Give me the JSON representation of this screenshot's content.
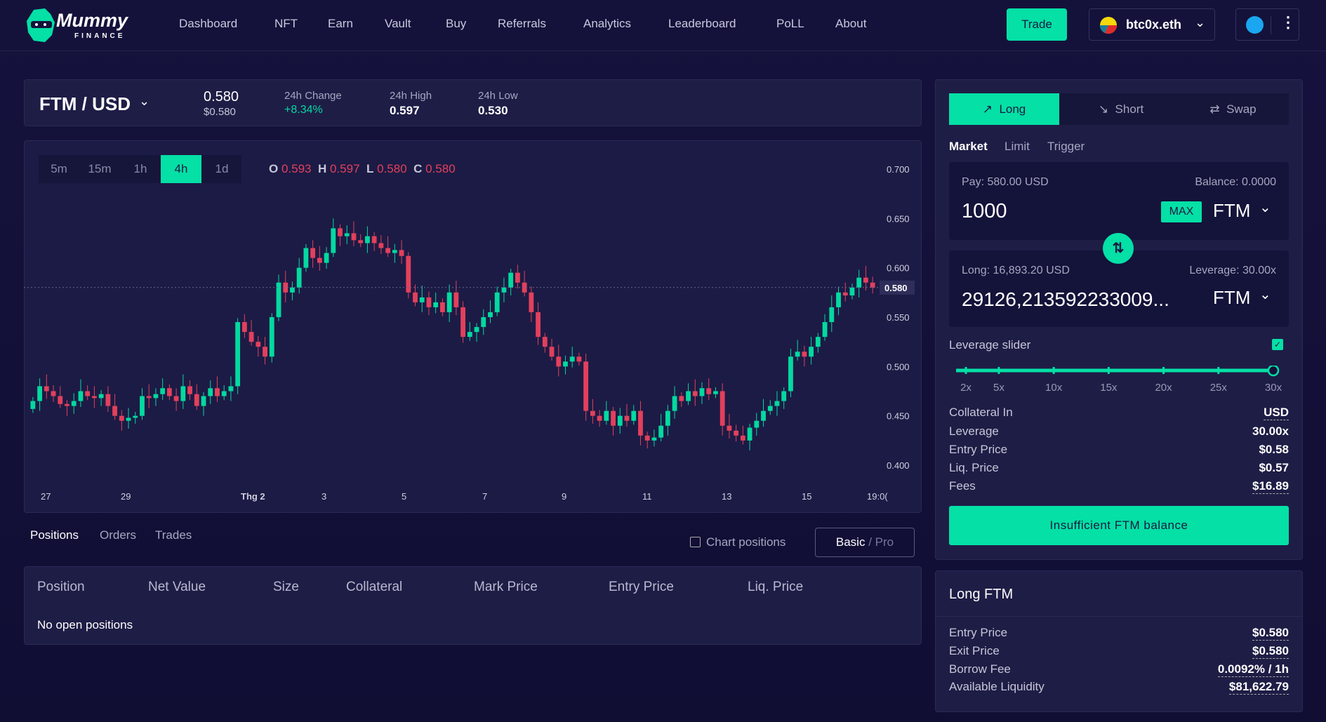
{
  "nav": {
    "brand": "Mummy",
    "brand_sub": "FINANCE",
    "items": [
      "Dashboard",
      "NFT",
      "Earn",
      "Vault",
      "Buy",
      "Referrals",
      "Analytics",
      "Leaderboard",
      "PoLL",
      "About"
    ],
    "trade": "Trade",
    "wallet": "btc0x.eth"
  },
  "ticker": {
    "pair": "FTM / USD",
    "price": "0.580",
    "price_usd": "$0.580",
    "change_label": "24h Change",
    "change": "+8.34%",
    "high_label": "24h High",
    "high": "0.597",
    "low_label": "24h Low",
    "low": "0.530"
  },
  "chart": {
    "timeframes": [
      "5m",
      "15m",
      "1h",
      "4h",
      "1d"
    ],
    "active": "4h",
    "ohlc": {
      "O": "0.593",
      "H": "0.597",
      "L": "0.580",
      "C": "0.580"
    },
    "current_label": "0.580"
  },
  "chart_data": {
    "type": "candlestick",
    "y_ticks": [
      "0.700",
      "0.650",
      "0.600",
      "0.550",
      "0.500",
      "0.450",
      "0.400"
    ],
    "ylim": [
      0.39,
      0.71
    ],
    "x_ticks": [
      "27",
      "29",
      "Thg 2",
      "3",
      "5",
      "7",
      "9",
      "11",
      "13",
      "15",
      "19:0("
    ],
    "current": 0.58,
    "closes": [
      0.465,
      0.48,
      0.475,
      0.47,
      0.462,
      0.46,
      0.465,
      0.475,
      0.47,
      0.468,
      0.472,
      0.46,
      0.45,
      0.445,
      0.448,
      0.45,
      0.47,
      0.468,
      0.472,
      0.478,
      0.47,
      0.465,
      0.48,
      0.472,
      0.46,
      0.47,
      0.478,
      0.47,
      0.475,
      0.48,
      0.545,
      0.535,
      0.525,
      0.52,
      0.51,
      0.55,
      0.585,
      0.575,
      0.58,
      0.6,
      0.62,
      0.61,
      0.605,
      0.615,
      0.64,
      0.632,
      0.635,
      0.628,
      0.625,
      0.632,
      0.625,
      0.62,
      0.615,
      0.618,
      0.612,
      0.575,
      0.565,
      0.57,
      0.56,
      0.565,
      0.555,
      0.575,
      0.56,
      0.53,
      0.535,
      0.54,
      0.55,
      0.555,
      0.575,
      0.58,
      0.595,
      0.585,
      0.575,
      0.555,
      0.53,
      0.52,
      0.51,
      0.5,
      0.505,
      0.51,
      0.505,
      0.455,
      0.45,
      0.445,
      0.455,
      0.44,
      0.45,
      0.445,
      0.455,
      0.43,
      0.425,
      0.428,
      0.44,
      0.455,
      0.47,
      0.465,
      0.475,
      0.47,
      0.478,
      0.472,
      0.475,
      0.44,
      0.435,
      0.43,
      0.425,
      0.438,
      0.445,
      0.455,
      0.46,
      0.465,
      0.475,
      0.51,
      0.515,
      0.51,
      0.52,
      0.53,
      0.545,
      0.56,
      0.575,
      0.572,
      0.58,
      0.59,
      0.585,
      0.58
    ]
  },
  "bottom": {
    "tabs": [
      "Positions",
      "Orders",
      "Trades"
    ],
    "chart_positions": "Chart positions",
    "basic": "Basic",
    "pro": "/ Pro",
    "columns": [
      "Position",
      "Net Value",
      "Size",
      "Collateral",
      "Mark Price",
      "Entry Price",
      "Liq. Price"
    ],
    "empty": "No open positions"
  },
  "trade": {
    "tabs": [
      "Long",
      "Short",
      "Swap"
    ],
    "order_types": [
      "Market",
      "Limit",
      "Trigger"
    ],
    "pay_label": "Pay: 580.00 USD",
    "balance": "Balance: 0.0000",
    "pay_value": "1000",
    "max": "MAX",
    "pay_token": "FTM",
    "long_label": "Long: 16,893.20 USD",
    "leverage_label": "Leverage: 30.00x",
    "long_value": "29126,213592233009...",
    "long_token": "FTM",
    "slider_label": "Leverage slider",
    "slider_enabled": true,
    "slider_marks": [
      "2x",
      "5x",
      "10x",
      "15x",
      "20x",
      "25x",
      "30x"
    ],
    "slider_value": 30,
    "info": [
      {
        "k": "Collateral In",
        "v": "USD"
      },
      {
        "k": "Leverage",
        "v": "30.00x"
      },
      {
        "k": "Entry Price",
        "v": "$0.58"
      },
      {
        "k": "Liq. Price",
        "v": "$0.57"
      },
      {
        "k": "Fees",
        "v": "$16.89"
      }
    ],
    "submit": "Insufficient FTM balance"
  },
  "long_panel": {
    "title": "Long FTM",
    "rows": [
      {
        "k": "Entry Price",
        "v": "$0.580"
      },
      {
        "k": "Exit Price",
        "v": "$0.580"
      },
      {
        "k": "Borrow Fee",
        "v": "0.0092% / 1h"
      },
      {
        "k": "Available Liquidity",
        "v": "$81,622.79"
      }
    ]
  },
  "colors": {
    "accent": "#04e0a6",
    "up": "#04d9a0",
    "down": "#e2405c",
    "bg": "#14123b"
  }
}
